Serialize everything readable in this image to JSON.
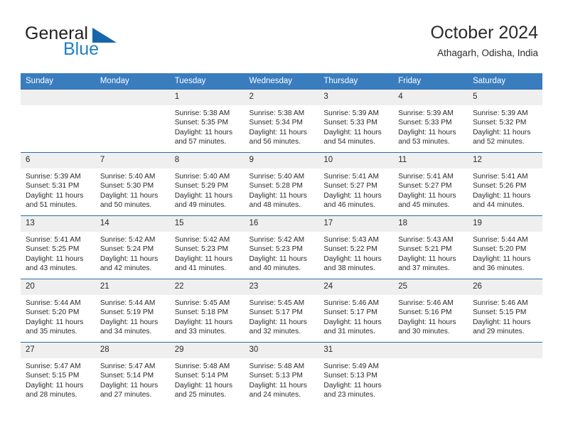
{
  "brand": {
    "name_part1": "General",
    "name_part2": "Blue",
    "triangle_icon": "brand-triangle-icon",
    "accent_color": "#1566ab"
  },
  "header": {
    "title": "October 2024",
    "location": "Athagarh, Odisha, India"
  },
  "theme": {
    "header_blue": "#3a7dbf",
    "border_blue": "#2f6ca6",
    "daynum_band": "#efefef",
    "text": "#2b2b2b"
  },
  "weekday_headers": [
    "Sunday",
    "Monday",
    "Tuesday",
    "Wednesday",
    "Thursday",
    "Friday",
    "Saturday"
  ],
  "labels": {
    "sunrise": "Sunrise:",
    "sunset": "Sunset:",
    "daylight": "Daylight:"
  },
  "weeks": [
    [
      {
        "day": "",
        "sunrise": "",
        "sunset": "",
        "daylight_1": "",
        "daylight_2": ""
      },
      {
        "day": "",
        "sunrise": "",
        "sunset": "",
        "daylight_1": "",
        "daylight_2": ""
      },
      {
        "day": "1",
        "sunrise": "Sunrise: 5:38 AM",
        "sunset": "Sunset: 5:35 PM",
        "daylight_1": "Daylight: 11 hours",
        "daylight_2": "and 57 minutes."
      },
      {
        "day": "2",
        "sunrise": "Sunrise: 5:38 AM",
        "sunset": "Sunset: 5:34 PM",
        "daylight_1": "Daylight: 11 hours",
        "daylight_2": "and 56 minutes."
      },
      {
        "day": "3",
        "sunrise": "Sunrise: 5:39 AM",
        "sunset": "Sunset: 5:33 PM",
        "daylight_1": "Daylight: 11 hours",
        "daylight_2": "and 54 minutes."
      },
      {
        "day": "4",
        "sunrise": "Sunrise: 5:39 AM",
        "sunset": "Sunset: 5:33 PM",
        "daylight_1": "Daylight: 11 hours",
        "daylight_2": "and 53 minutes."
      },
      {
        "day": "5",
        "sunrise": "Sunrise: 5:39 AM",
        "sunset": "Sunset: 5:32 PM",
        "daylight_1": "Daylight: 11 hours",
        "daylight_2": "and 52 minutes."
      }
    ],
    [
      {
        "day": "6",
        "sunrise": "Sunrise: 5:39 AM",
        "sunset": "Sunset: 5:31 PM",
        "daylight_1": "Daylight: 11 hours",
        "daylight_2": "and 51 minutes."
      },
      {
        "day": "7",
        "sunrise": "Sunrise: 5:40 AM",
        "sunset": "Sunset: 5:30 PM",
        "daylight_1": "Daylight: 11 hours",
        "daylight_2": "and 50 minutes."
      },
      {
        "day": "8",
        "sunrise": "Sunrise: 5:40 AM",
        "sunset": "Sunset: 5:29 PM",
        "daylight_1": "Daylight: 11 hours",
        "daylight_2": "and 49 minutes."
      },
      {
        "day": "9",
        "sunrise": "Sunrise: 5:40 AM",
        "sunset": "Sunset: 5:28 PM",
        "daylight_1": "Daylight: 11 hours",
        "daylight_2": "and 48 minutes."
      },
      {
        "day": "10",
        "sunrise": "Sunrise: 5:41 AM",
        "sunset": "Sunset: 5:27 PM",
        "daylight_1": "Daylight: 11 hours",
        "daylight_2": "and 46 minutes."
      },
      {
        "day": "11",
        "sunrise": "Sunrise: 5:41 AM",
        "sunset": "Sunset: 5:27 PM",
        "daylight_1": "Daylight: 11 hours",
        "daylight_2": "and 45 minutes."
      },
      {
        "day": "12",
        "sunrise": "Sunrise: 5:41 AM",
        "sunset": "Sunset: 5:26 PM",
        "daylight_1": "Daylight: 11 hours",
        "daylight_2": "and 44 minutes."
      }
    ],
    [
      {
        "day": "13",
        "sunrise": "Sunrise: 5:41 AM",
        "sunset": "Sunset: 5:25 PM",
        "daylight_1": "Daylight: 11 hours",
        "daylight_2": "and 43 minutes."
      },
      {
        "day": "14",
        "sunrise": "Sunrise: 5:42 AM",
        "sunset": "Sunset: 5:24 PM",
        "daylight_1": "Daylight: 11 hours",
        "daylight_2": "and 42 minutes."
      },
      {
        "day": "15",
        "sunrise": "Sunrise: 5:42 AM",
        "sunset": "Sunset: 5:23 PM",
        "daylight_1": "Daylight: 11 hours",
        "daylight_2": "and 41 minutes."
      },
      {
        "day": "16",
        "sunrise": "Sunrise: 5:42 AM",
        "sunset": "Sunset: 5:23 PM",
        "daylight_1": "Daylight: 11 hours",
        "daylight_2": "and 40 minutes."
      },
      {
        "day": "17",
        "sunrise": "Sunrise: 5:43 AM",
        "sunset": "Sunset: 5:22 PM",
        "daylight_1": "Daylight: 11 hours",
        "daylight_2": "and 38 minutes."
      },
      {
        "day": "18",
        "sunrise": "Sunrise: 5:43 AM",
        "sunset": "Sunset: 5:21 PM",
        "daylight_1": "Daylight: 11 hours",
        "daylight_2": "and 37 minutes."
      },
      {
        "day": "19",
        "sunrise": "Sunrise: 5:44 AM",
        "sunset": "Sunset: 5:20 PM",
        "daylight_1": "Daylight: 11 hours",
        "daylight_2": "and 36 minutes."
      }
    ],
    [
      {
        "day": "20",
        "sunrise": "Sunrise: 5:44 AM",
        "sunset": "Sunset: 5:20 PM",
        "daylight_1": "Daylight: 11 hours",
        "daylight_2": "and 35 minutes."
      },
      {
        "day": "21",
        "sunrise": "Sunrise: 5:44 AM",
        "sunset": "Sunset: 5:19 PM",
        "daylight_1": "Daylight: 11 hours",
        "daylight_2": "and 34 minutes."
      },
      {
        "day": "22",
        "sunrise": "Sunrise: 5:45 AM",
        "sunset": "Sunset: 5:18 PM",
        "daylight_1": "Daylight: 11 hours",
        "daylight_2": "and 33 minutes."
      },
      {
        "day": "23",
        "sunrise": "Sunrise: 5:45 AM",
        "sunset": "Sunset: 5:17 PM",
        "daylight_1": "Daylight: 11 hours",
        "daylight_2": "and 32 minutes."
      },
      {
        "day": "24",
        "sunrise": "Sunrise: 5:46 AM",
        "sunset": "Sunset: 5:17 PM",
        "daylight_1": "Daylight: 11 hours",
        "daylight_2": "and 31 minutes."
      },
      {
        "day": "25",
        "sunrise": "Sunrise: 5:46 AM",
        "sunset": "Sunset: 5:16 PM",
        "daylight_1": "Daylight: 11 hours",
        "daylight_2": "and 30 minutes."
      },
      {
        "day": "26",
        "sunrise": "Sunrise: 5:46 AM",
        "sunset": "Sunset: 5:15 PM",
        "daylight_1": "Daylight: 11 hours",
        "daylight_2": "and 29 minutes."
      }
    ],
    [
      {
        "day": "27",
        "sunrise": "Sunrise: 5:47 AM",
        "sunset": "Sunset: 5:15 PM",
        "daylight_1": "Daylight: 11 hours",
        "daylight_2": "and 28 minutes."
      },
      {
        "day": "28",
        "sunrise": "Sunrise: 5:47 AM",
        "sunset": "Sunset: 5:14 PM",
        "daylight_1": "Daylight: 11 hours",
        "daylight_2": "and 27 minutes."
      },
      {
        "day": "29",
        "sunrise": "Sunrise: 5:48 AM",
        "sunset": "Sunset: 5:14 PM",
        "daylight_1": "Daylight: 11 hours",
        "daylight_2": "and 25 minutes."
      },
      {
        "day": "30",
        "sunrise": "Sunrise: 5:48 AM",
        "sunset": "Sunset: 5:13 PM",
        "daylight_1": "Daylight: 11 hours",
        "daylight_2": "and 24 minutes."
      },
      {
        "day": "31",
        "sunrise": "Sunrise: 5:49 AM",
        "sunset": "Sunset: 5:13 PM",
        "daylight_1": "Daylight: 11 hours",
        "daylight_2": "and 23 minutes."
      },
      {
        "day": "",
        "sunrise": "",
        "sunset": "",
        "daylight_1": "",
        "daylight_2": ""
      },
      {
        "day": "",
        "sunrise": "",
        "sunset": "",
        "daylight_1": "",
        "daylight_2": ""
      }
    ]
  ]
}
